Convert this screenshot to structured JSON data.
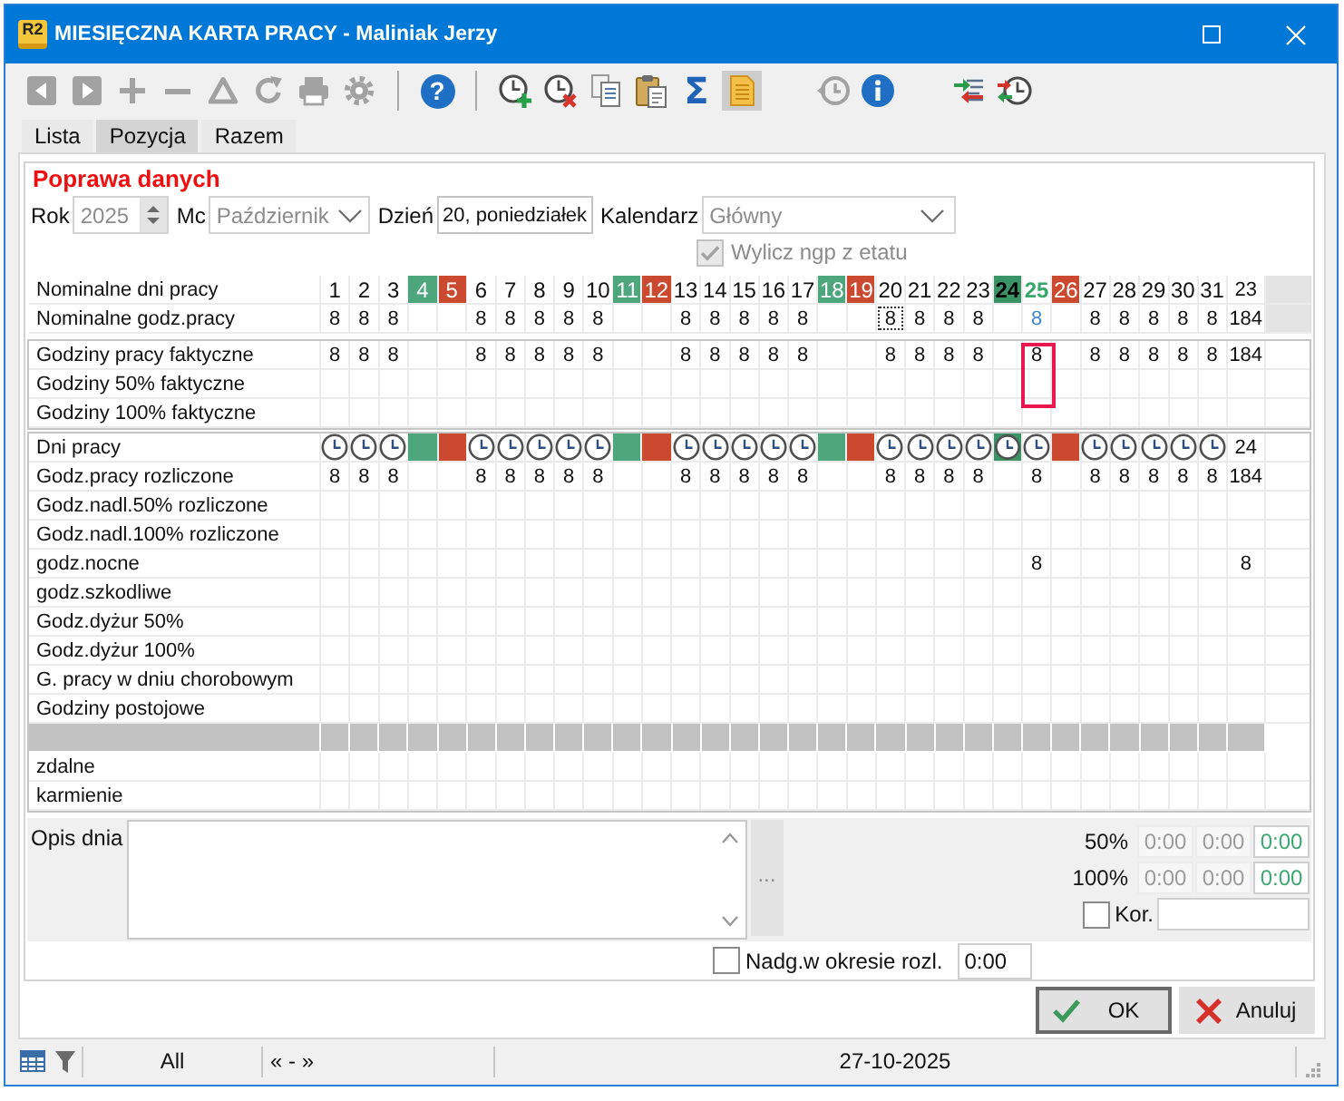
{
  "window": {
    "app_badge": "R2",
    "title": "MIESIĘCZNA KARTA PRACY - Maliniak Jerzy"
  },
  "toolbar": [
    {
      "kind": "prev",
      "disabled": true,
      "pressed": false
    },
    {
      "kind": "next",
      "disabled": true,
      "pressed": false
    },
    {
      "kind": "add",
      "disabled": true,
      "pressed": false
    },
    {
      "kind": "remove",
      "disabled": true,
      "pressed": false
    },
    {
      "kind": "warning",
      "disabled": true,
      "pressed": false
    },
    {
      "kind": "refresh",
      "disabled": true,
      "pressed": false
    },
    {
      "kind": "print",
      "disabled": true,
      "pressed": false
    },
    {
      "kind": "settings",
      "disabled": true,
      "pressed": false
    },
    {
      "kind": "separator"
    },
    {
      "kind": "help",
      "glyph": "?",
      "disabled": false,
      "pressed": false
    },
    {
      "kind": "separator"
    },
    {
      "kind": "clock-add",
      "disabled": false,
      "pressed": false
    },
    {
      "kind": "clock-delete",
      "disabled": false,
      "pressed": false
    },
    {
      "kind": "copy",
      "disabled": false,
      "pressed": false
    },
    {
      "kind": "paste",
      "disabled": false,
      "pressed": false
    },
    {
      "kind": "sum",
      "glyph": "Σ",
      "disabled": false,
      "pressed": false
    },
    {
      "kind": "document",
      "disabled": false,
      "pressed": true
    },
    {
      "kind": "gap"
    },
    {
      "kind": "clock-arrow",
      "disabled": true,
      "pressed": false
    },
    {
      "kind": "info",
      "disabled": false,
      "pressed": false
    },
    {
      "kind": "gap"
    },
    {
      "kind": "transfer",
      "disabled": false,
      "pressed": false
    },
    {
      "kind": "clock-transfer",
      "disabled": false,
      "pressed": false
    }
  ],
  "tabs": [
    {
      "label": "Lista",
      "selected": false
    },
    {
      "label": "Pozycja",
      "selected": true
    },
    {
      "label": "Razem",
      "selected": false
    }
  ],
  "form": {
    "title": "Poprawa danych",
    "fields": [
      {
        "kind": "spin",
        "label": "Rok",
        "value": "2025",
        "disabled": true
      },
      {
        "kind": "combo",
        "label": "Mc",
        "value": "Październik",
        "disabled": true
      },
      {
        "kind": "text",
        "label": "Dzień",
        "value": "20, poniedziałek",
        "disabled": false
      },
      {
        "kind": "combo",
        "label": "Kalendarz",
        "value": "Główny",
        "disabled": true
      }
    ],
    "checkbox": {
      "label": "Wylicz ngp z etatu",
      "checked": true,
      "disabled": true
    }
  },
  "grid": {
    "days": [
      {
        "label": "1",
        "kind": "work",
        "selected": false,
        "framed": false
      },
      {
        "label": "2",
        "kind": "work",
        "selected": false,
        "framed": false
      },
      {
        "label": "3",
        "kind": "work",
        "selected": false,
        "framed": false
      },
      {
        "label": "4",
        "kind": "saturday",
        "selected": false,
        "framed": false
      },
      {
        "label": "5",
        "kind": "sunday",
        "selected": false,
        "framed": false
      },
      {
        "label": "6",
        "kind": "work",
        "selected": false,
        "framed": false
      },
      {
        "label": "7",
        "kind": "work",
        "selected": false,
        "framed": false
      },
      {
        "label": "8",
        "kind": "work",
        "selected": false,
        "framed": false
      },
      {
        "label": "9",
        "kind": "work",
        "selected": false,
        "framed": false
      },
      {
        "label": "10",
        "kind": "work",
        "selected": false,
        "framed": false
      },
      {
        "label": "11",
        "kind": "saturday",
        "selected": false,
        "framed": false
      },
      {
        "label": "12",
        "kind": "sunday",
        "selected": false,
        "framed": false
      },
      {
        "label": "13",
        "kind": "work",
        "selected": false,
        "framed": false
      },
      {
        "label": "14",
        "kind": "work",
        "selected": false,
        "framed": false
      },
      {
        "label": "15",
        "kind": "work",
        "selected": false,
        "framed": false
      },
      {
        "label": "16",
        "kind": "work",
        "selected": false,
        "framed": false
      },
      {
        "label": "17",
        "kind": "work",
        "selected": false,
        "framed": false
      },
      {
        "label": "18",
        "kind": "saturday",
        "selected": false,
        "framed": false
      },
      {
        "label": "19",
        "kind": "sunday",
        "selected": false,
        "framed": false
      },
      {
        "label": "20",
        "kind": "work",
        "selected": true,
        "framed": false
      },
      {
        "label": "21",
        "kind": "work",
        "selected": false,
        "framed": false
      },
      {
        "label": "22",
        "kind": "work",
        "selected": false,
        "framed": false
      },
      {
        "label": "23",
        "kind": "work",
        "selected": false,
        "framed": false
      },
      {
        "label": "24",
        "kind": "day-off",
        "selected": false,
        "framed": false
      },
      {
        "label": "25",
        "kind": "working-saturday",
        "selected": false,
        "framed": true
      },
      {
        "label": "26",
        "kind": "sunday",
        "selected": false,
        "framed": false
      },
      {
        "label": "27",
        "kind": "work",
        "selected": false,
        "framed": false
      },
      {
        "label": "28",
        "kind": "work",
        "selected": false,
        "framed": false
      },
      {
        "label": "29",
        "kind": "work",
        "selected": false,
        "framed": false
      },
      {
        "label": "30",
        "kind": "work",
        "selected": false,
        "framed": false
      },
      {
        "label": "31",
        "kind": "work",
        "selected": false,
        "framed": false
      }
    ],
    "sections": [
      {
        "kind": "calendar",
        "framed": false,
        "rows": [
          {
            "kind": "header",
            "label": "Nominalne dni pracy",
            "total": "23",
            "focused": false
          },
          {
            "kind": "values",
            "label": "Nominalne godz.pracy",
            "cells": [
              {
                "kind": "hours",
                "text": "8"
              },
              {
                "kind": "hours",
                "text": "8"
              },
              {
                "kind": "hours",
                "text": "8"
              },
              {
                "kind": "blank"
              },
              {
                "kind": "blank"
              },
              {
                "kind": "hours",
                "text": "8"
              },
              {
                "kind": "hours",
                "text": "8"
              },
              {
                "kind": "hours",
                "text": "8"
              },
              {
                "kind": "hours",
                "text": "8"
              },
              {
                "kind": "hours",
                "text": "8"
              },
              {
                "kind": "blank"
              },
              {
                "kind": "blank"
              },
              {
                "kind": "hours",
                "text": "8"
              },
              {
                "kind": "hours",
                "text": "8"
              },
              {
                "kind": "hours",
                "text": "8"
              },
              {
                "kind": "hours",
                "text": "8"
              },
              {
                "kind": "hours",
                "text": "8"
              },
              {
                "kind": "blank"
              },
              {
                "kind": "blank"
              },
              {
                "kind": "hours",
                "text": "8"
              },
              {
                "kind": "hours",
                "text": "8"
              },
              {
                "kind": "hours",
                "text": "8"
              },
              {
                "kind": "hours",
                "text": "8"
              },
              {
                "kind": "blank"
              },
              {
                "kind": "changed",
                "text": "8"
              },
              {
                "kind": "blank"
              },
              {
                "kind": "hours",
                "text": "8"
              },
              {
                "kind": "hours",
                "text": "8"
              },
              {
                "kind": "hours",
                "text": "8"
              },
              {
                "kind": "hours",
                "text": "8"
              },
              {
                "kind": "hours",
                "text": "8"
              }
            ],
            "total": "184",
            "focused": true
          }
        ]
      },
      {
        "kind": "boxed",
        "framed": true,
        "rows": [
          {
            "kind": "values",
            "label": "Godziny pracy faktyczne",
            "cells": [
              {
                "kind": "hours",
                "text": "8"
              },
              {
                "kind": "hours",
                "text": "8"
              },
              {
                "kind": "hours",
                "text": "8"
              },
              {
                "kind": "blank"
              },
              {
                "kind": "blank"
              },
              {
                "kind": "hours",
                "text": "8"
              },
              {
                "kind": "hours",
                "text": "8"
              },
              {
                "kind": "hours",
                "text": "8"
              },
              {
                "kind": "hours",
                "text": "8"
              },
              {
                "kind": "hours",
                "text": "8"
              },
              {
                "kind": "blank"
              },
              {
                "kind": "blank"
              },
              {
                "kind": "hours",
                "text": "8"
              },
              {
                "kind": "hours",
                "text": "8"
              },
              {
                "kind": "hours",
                "text": "8"
              },
              {
                "kind": "hours",
                "text": "8"
              },
              {
                "kind": "hours",
                "text": "8"
              },
              {
                "kind": "blank"
              },
              {
                "kind": "blank"
              },
              {
                "kind": "hours",
                "text": "8"
              },
              {
                "kind": "hours",
                "text": "8"
              },
              {
                "kind": "hours",
                "text": "8"
              },
              {
                "kind": "hours",
                "text": "8"
              },
              {
                "kind": "blank"
              },
              {
                "kind": "hours",
                "text": "8"
              },
              {
                "kind": "blank"
              },
              {
                "kind": "hours",
                "text": "8"
              },
              {
                "kind": "hours",
                "text": "8"
              },
              {
                "kind": "hours",
                "text": "8"
              },
              {
                "kind": "hours",
                "text": "8"
              },
              {
                "kind": "hours",
                "text": "8"
              }
            ],
            "total": "184",
            "focused": false
          },
          {
            "kind": "values",
            "label": "Godziny 50% faktyczne",
            "focused": false
          },
          {
            "kind": "values",
            "label": "Godziny 100% faktyczne",
            "focused": false
          }
        ]
      },
      {
        "kind": "boxed",
        "framed": false,
        "rows": [
          {
            "kind": "marks",
            "label": "Dni pracy",
            "cells": [
              {
                "kind": "clock"
              },
              {
                "kind": "clock"
              },
              {
                "kind": "clock"
              },
              {
                "kind": "saturday"
              },
              {
                "kind": "sunday"
              },
              {
                "kind": "clock"
              },
              {
                "kind": "clock"
              },
              {
                "kind": "clock"
              },
              {
                "kind": "clock"
              },
              {
                "kind": "clock"
              },
              {
                "kind": "saturday"
              },
              {
                "kind": "sunday"
              },
              {
                "kind": "clock"
              },
              {
                "kind": "clock"
              },
              {
                "kind": "clock"
              },
              {
                "kind": "clock"
              },
              {
                "kind": "clock"
              },
              {
                "kind": "saturday"
              },
              {
                "kind": "sunday"
              },
              {
                "kind": "clock"
              },
              {
                "kind": "clock"
              },
              {
                "kind": "clock"
              },
              {
                "kind": "clock"
              },
              {
                "kind": "clock-day-off"
              },
              {
                "kind": "clock"
              },
              {
                "kind": "sunday"
              },
              {
                "kind": "clock"
              },
              {
                "kind": "clock"
              },
              {
                "kind": "clock"
              },
              {
                "kind": "clock"
              },
              {
                "kind": "clock"
              }
            ],
            "total": "24",
            "focused": false
          },
          {
            "kind": "values",
            "label": "Godz.pracy rozliczone",
            "cells": [
              {
                "kind": "hours",
                "text": "8"
              },
              {
                "kind": "hours",
                "text": "8"
              },
              {
                "kind": "hours",
                "text": "8"
              },
              {
                "kind": "blank"
              },
              {
                "kind": "blank"
              },
              {
                "kind": "hours",
                "text": "8"
              },
              {
                "kind": "hours",
                "text": "8"
              },
              {
                "kind": "hours",
                "text": "8"
              },
              {
                "kind": "hours",
                "text": "8"
              },
              {
                "kind": "hours",
                "text": "8"
              },
              {
                "kind": "blank"
              },
              {
                "kind": "blank"
              },
              {
                "kind": "hours",
                "text": "8"
              },
              {
                "kind": "hours",
                "text": "8"
              },
              {
                "kind": "hours",
                "text": "8"
              },
              {
                "kind": "hours",
                "text": "8"
              },
              {
                "kind": "hours",
                "text": "8"
              },
              {
                "kind": "blank"
              },
              {
                "kind": "blank"
              },
              {
                "kind": "hours",
                "text": "8"
              },
              {
                "kind": "hours",
                "text": "8"
              },
              {
                "kind": "hours",
                "text": "8"
              },
              {
                "kind": "hours",
                "text": "8"
              },
              {
                "kind": "blank"
              },
              {
                "kind": "hours",
                "text": "8"
              },
              {
                "kind": "blank"
              },
              {
                "kind": "hours",
                "text": "8"
              },
              {
                "kind": "hours",
                "text": "8"
              },
              {
                "kind": "hours",
                "text": "8"
              },
              {
                "kind": "hours",
                "text": "8"
              },
              {
                "kind": "hours",
                "text": "8"
              }
            ],
            "total": "184",
            "focused": false
          },
          {
            "kind": "values",
            "label": "Godz.nadl.50% rozliczone",
            "focused": false
          },
          {
            "kind": "values",
            "label": "Godz.nadl.100% rozliczone",
            "focused": false
          },
          {
            "kind": "values",
            "label": "godz.nocne",
            "cells": [
              {
                "kind": "blank"
              },
              {
                "kind": "blank"
              },
              {
                "kind": "blank"
              },
              {
                "kind": "blank"
              },
              {
                "kind": "blank"
              },
              {
                "kind": "blank"
              },
              {
                "kind": "blank"
              },
              {
                "kind": "blank"
              },
              {
                "kind": "blank"
              },
              {
                "kind": "blank"
              },
              {
                "kind": "blank"
              },
              {
                "kind": "blank"
              },
              {
                "kind": "blank"
              },
              {
                "kind": "blank"
              },
              {
                "kind": "blank"
              },
              {
                "kind": "blank"
              },
              {
                "kind": "blank"
              },
              {
                "kind": "blank"
              },
              {
                "kind": "blank"
              },
              {
                "kind": "blank"
              },
              {
                "kind": "blank"
              },
              {
                "kind": "blank"
              },
              {
                "kind": "blank"
              },
              {
                "kind": "blank"
              },
              {
                "kind": "hours",
                "text": "8"
              },
              {
                "kind": "blank"
              },
              {
                "kind": "blank"
              },
              {
                "kind": "blank"
              },
              {
                "kind": "blank"
              },
              {
                "kind": "blank"
              },
              {
                "kind": "blank"
              }
            ],
            "total": "8",
            "focused": false
          },
          {
            "kind": "values",
            "label": "godz.szkodliwe",
            "focused": false
          },
          {
            "kind": "values",
            "label": "Godz.dyżur 50%",
            "focused": false
          },
          {
            "kind": "values",
            "label": "Godz.dyżur 100%",
            "focused": false
          },
          {
            "kind": "values",
            "label": "G. pracy w dniu chorobowym",
            "focused": false
          },
          {
            "kind": "values",
            "label": "Godziny postojowe",
            "focused": false
          },
          {
            "kind": "separator"
          },
          {
            "kind": "values",
            "label": "zdalne",
            "focused": false
          },
          {
            "kind": "values",
            "label": "karmienie",
            "focused": false
          }
        ]
      }
    ]
  },
  "details": {
    "description": {
      "label": "Opis dnia",
      "more_button": "..."
    },
    "overtime": {
      "rows": [
        {
          "label": "50%",
          "cells": [
            {
              "value": "0:00",
              "disabled": true
            },
            {
              "value": "0:00",
              "disabled": true
            },
            {
              "value": "0:00",
              "disabled": false
            }
          ]
        },
        {
          "label": "100%",
          "cells": [
            {
              "value": "0:00",
              "disabled": true
            },
            {
              "value": "0:00",
              "disabled": true
            },
            {
              "value": "0:00",
              "disabled": false
            }
          ]
        }
      ],
      "correction": {
        "label": "Kor.",
        "checked": false
      }
    },
    "overtime_in_period": {
      "label": "Nadg.w okresie rozl.",
      "checked": false,
      "value": "0:00"
    }
  },
  "buttons": [
    {
      "kind": "ok",
      "label": "OK",
      "default": true
    },
    {
      "kind": "cancel",
      "label": "Anuluj",
      "default": false
    }
  ],
  "status_bar": {
    "filter": "All",
    "range": "« - »",
    "date": "27-10-2025"
  }
}
